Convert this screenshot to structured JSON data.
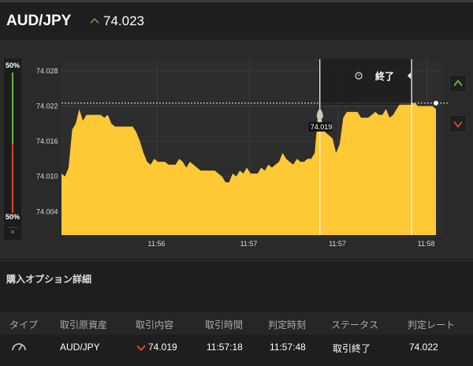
{
  "header": {
    "pair": "AUD/JPY",
    "rate": "74.023",
    "rate_icon": "chevron-up-icon",
    "up_color": "#6db33f",
    "down_color": "#d9462b"
  },
  "gauge": {
    "top_label": "50%",
    "bottom_label": "50%",
    "close": "×"
  },
  "overlay": {
    "end_label": "終了",
    "marker_value": "74.019"
  },
  "chart_data": {
    "type": "area",
    "color": "#ffc835",
    "ylim": [
      74.0,
      74.03
    ],
    "yticks": [
      "74.028",
      "74.022",
      "74.016",
      "74.010",
      "74.004"
    ],
    "ytick_values": [
      74.028,
      74.022,
      74.016,
      74.01,
      74.004
    ],
    "xticks": [
      "11:56",
      "11:57",
      "11:57",
      "11:58"
    ],
    "xtick_positions": [
      0.27,
      0.53,
      0.78,
      1.03
    ],
    "reference_line": 74.0225,
    "series": [
      {
        "values": [
          74.0105,
          74.01,
          74.0115,
          74.018,
          74.019,
          74.0215,
          74.0195,
          74.0205,
          74.0205,
          74.0205,
          74.0205,
          74.0205,
          74.02,
          74.0205,
          74.019,
          74.0185,
          74.0185,
          74.0185,
          74.0185,
          74.0185,
          74.0185,
          74.0175,
          74.016,
          74.014,
          74.0125,
          74.012,
          74.013,
          74.0125,
          74.0125,
          74.0125,
          74.012,
          74.012,
          74.012,
          74.013,
          74.0125,
          74.0115,
          74.0125,
          74.012,
          74.0115,
          74.011,
          74.011,
          74.011,
          74.011,
          74.011,
          74.0105,
          74.01,
          74.009,
          74.009,
          74.0105,
          74.01,
          74.011,
          74.0105,
          74.0115,
          74.0105,
          74.0105,
          74.0105,
          74.0115,
          74.011,
          74.012,
          74.0115,
          74.012,
          74.0125,
          74.014,
          74.013,
          74.0125,
          74.012,
          74.013,
          74.0125,
          74.0125,
          74.013,
          74.013,
          74.014,
          74.021,
          74.0195,
          74.0175,
          74.017,
          74.0165,
          74.014,
          74.0155,
          74.02,
          74.021,
          74.021,
          74.021,
          74.021,
          74.02,
          74.02,
          74.02,
          74.0205,
          74.021,
          74.0205,
          74.0205,
          74.0215,
          74.02,
          74.0205,
          74.0215,
          74.0225,
          74.0225,
          74.0225,
          74.0225,
          74.0225,
          74.022,
          74.022,
          74.022,
          74.022,
          74.022,
          74.0215
        ]
      }
    ],
    "entry_value": 74.019,
    "entry_index": 0.69,
    "end_index": 0.935
  },
  "side_buttons": {
    "up_icon": "chevron-up-icon",
    "down_icon": "chevron-down-icon"
  },
  "section": {
    "title": "購入オプション詳細"
  },
  "table": {
    "headers": [
      "タイプ",
      "取引原資産",
      "取引内容",
      "取引時間",
      "判定時刻",
      "ステータス",
      "判定レート"
    ],
    "row": {
      "type_icon": "gauge-icon",
      "asset": "AUD/JPY",
      "direction_icon": "chevron-down-icon",
      "content": "74.019",
      "trade_time": "11:57:18",
      "judge_time": "11:57:48",
      "status": "取引終了",
      "judge_rate": "74.022"
    }
  }
}
